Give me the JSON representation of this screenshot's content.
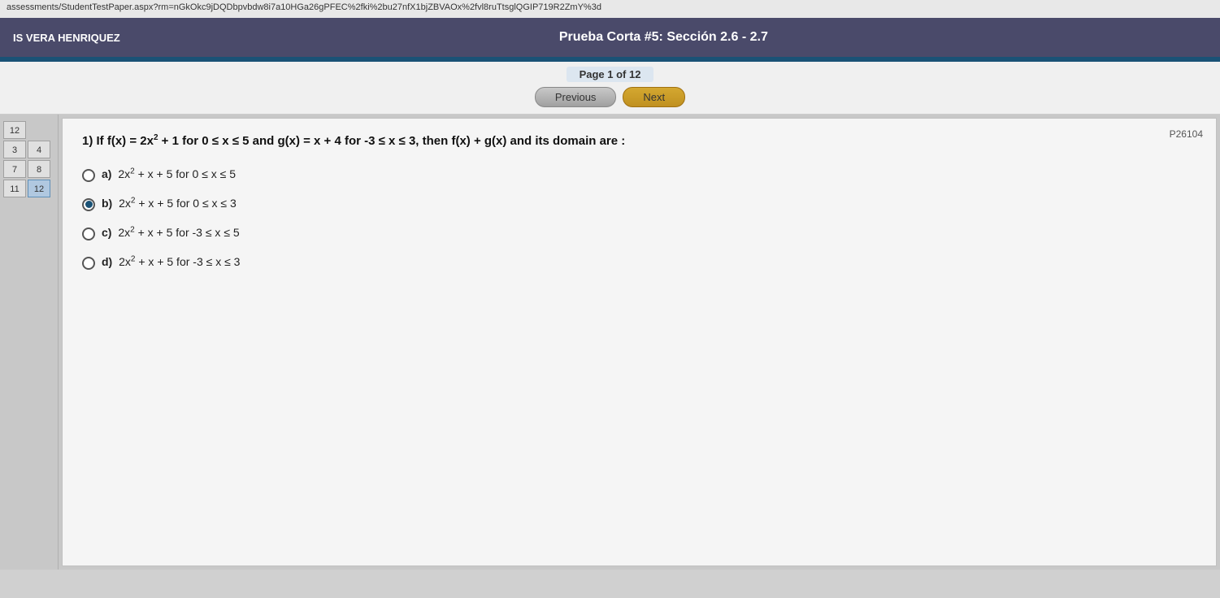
{
  "url_bar": {
    "text": "assessments/StudentTestPaper.aspx?rm=nGkOkc9jDQDbpvbdw8i7a10HGa26gPFEC%2fki%2bu27nfX1bjZBVAOx%2fvl8ruTtsglQGIP719R2ZmY%3d"
  },
  "header": {
    "left_text": "IS VERA HENRIQUEZ",
    "center_text": "Prueba Corta #5: Sección 2.6 - 2.7"
  },
  "page_info": {
    "page_text": "Page 1 of 12",
    "previous_label": "Previous",
    "next_label": "Next"
  },
  "sidebar": {
    "items": [
      {
        "label": "12",
        "active": false
      },
      {
        "label": "3",
        "active": false
      },
      {
        "label": "4",
        "active": false
      },
      {
        "label": "7",
        "active": false
      },
      {
        "label": "8",
        "active": false
      },
      {
        "label": "11",
        "active": false
      },
      {
        "label": "12",
        "active": true
      }
    ]
  },
  "question": {
    "number": "1)",
    "badge": "P26104",
    "text": "If f(x) = 2x² + 1 for 0 ≤ x ≤ 5 and g(x) = x + 4 for -3 ≤ x ≤ 3, then f(x) + g(x) and its domain are :",
    "options": [
      {
        "label": "a)",
        "text": "2x² + x + 5 for 0 ≤ x ≤ 5",
        "selected": false
      },
      {
        "label": "b)",
        "text": "2x² + x + 5 for 0 ≤ x ≤ 3",
        "selected": true
      },
      {
        "label": "c)",
        "text": "2x² + x + 5 for -3 ≤ x ≤ 5",
        "selected": false
      },
      {
        "label": "d)",
        "text": "2x² + x + 5 for -3 ≤ x ≤ 3",
        "selected": false
      }
    ]
  }
}
